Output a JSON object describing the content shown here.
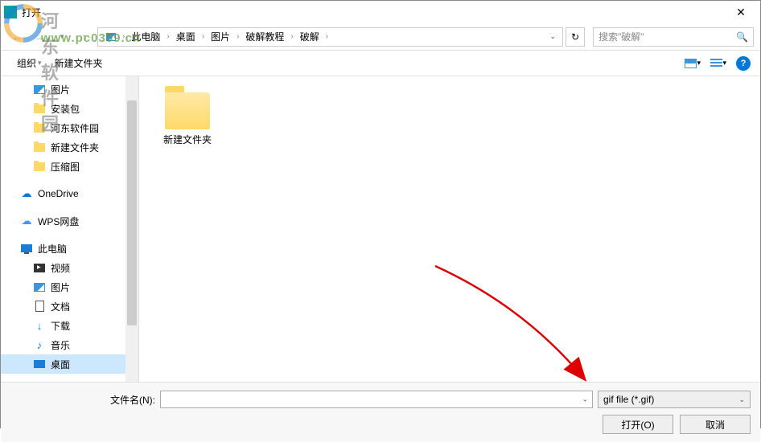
{
  "window": {
    "title": "打开"
  },
  "breadcrumb": [
    "此电脑",
    "桌面",
    "图片",
    "破解教程",
    "破解"
  ],
  "search": {
    "placeholder": "搜索\"破解\""
  },
  "toolbar": {
    "organize": "组织",
    "newfolder": "新建文件夹"
  },
  "sidebar": {
    "items": [
      {
        "label": "图片",
        "type": "pic"
      },
      {
        "label": "安装包",
        "type": "folder"
      },
      {
        "label": "河东软件园",
        "type": "folder"
      },
      {
        "label": "新建文件夹",
        "type": "folder"
      },
      {
        "label": "压缩图",
        "type": "folder"
      },
      {
        "label": "OneDrive",
        "type": "onedrive"
      },
      {
        "label": "WPS网盘",
        "type": "wps"
      },
      {
        "label": "此电脑",
        "type": "pc"
      },
      {
        "label": "视频",
        "type": "video"
      },
      {
        "label": "图片",
        "type": "pic"
      },
      {
        "label": "文档",
        "type": "doc"
      },
      {
        "label": "下载",
        "type": "download"
      },
      {
        "label": "音乐",
        "type": "music"
      },
      {
        "label": "桌面",
        "type": "desktop"
      }
    ]
  },
  "content": {
    "items": [
      {
        "name": "新建文件夹"
      }
    ]
  },
  "bottom": {
    "filename_label": "文件名(N):",
    "filename_value": "",
    "filter_value": "gif file (*.gif)",
    "open_label": "打开(O)",
    "cancel_label": "取消"
  },
  "watermark": {
    "text": "河东软件园",
    "url": "www.pc0359.cn"
  }
}
